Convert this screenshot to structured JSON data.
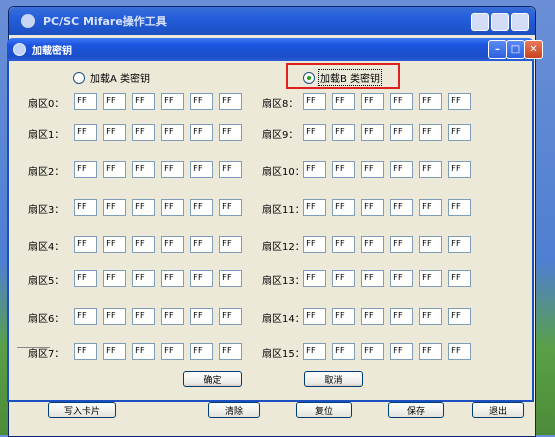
{
  "app_window": {
    "title": "PC/SC Mifare操作工具"
  },
  "bottom_buttons": {
    "write_card": "写入卡片",
    "clear": "清除",
    "reset": "复位",
    "save": "保存",
    "exit": "退出"
  },
  "dialog": {
    "title": "加载密钥",
    "radio_a_label": "加载A 类密钥",
    "radio_b_label": "加载B 类密钥",
    "selected_radio": "B",
    "ok_label": "确定",
    "cancel_label": "取消"
  },
  "sectors": [
    {
      "label": "扇区0：",
      "keys": [
        "FF",
        "FF",
        "FF",
        "FF",
        "FF",
        "FF"
      ]
    },
    {
      "label": "扇区1：",
      "keys": [
        "FF",
        "FF",
        "FF",
        "FF",
        "FF",
        "FF"
      ]
    },
    {
      "label": "扇区2：",
      "keys": [
        "FF",
        "FF",
        "FF",
        "FF",
        "FF",
        "FF"
      ]
    },
    {
      "label": "扇区3：",
      "keys": [
        "FF",
        "FF",
        "FF",
        "FF",
        "FF",
        "FF"
      ]
    },
    {
      "label": "扇区4：",
      "keys": [
        "FF",
        "FF",
        "FF",
        "FF",
        "FF",
        "FF"
      ]
    },
    {
      "label": "扇区5：",
      "keys": [
        "FF",
        "FF",
        "FF",
        "FF",
        "FF",
        "FF"
      ]
    },
    {
      "label": "扇区6：",
      "keys": [
        "FF",
        "FF",
        "FF",
        "FF",
        "FF",
        "FF"
      ]
    },
    {
      "label": "扇区7：",
      "keys": [
        "FF",
        "FF",
        "FF",
        "FF",
        "FF",
        "FF"
      ]
    },
    {
      "label": "扇区8：",
      "keys": [
        "FF",
        "FF",
        "FF",
        "FF",
        "FF",
        "FF"
      ]
    },
    {
      "label": "扇区9：",
      "keys": [
        "FF",
        "FF",
        "FF",
        "FF",
        "FF",
        "FF"
      ]
    },
    {
      "label": "扇区10：",
      "keys": [
        "FF",
        "FF",
        "FF",
        "FF",
        "FF",
        "FF"
      ]
    },
    {
      "label": "扇区11：",
      "keys": [
        "FF",
        "FF",
        "FF",
        "FF",
        "FF",
        "FF"
      ]
    },
    {
      "label": "扇区12：",
      "keys": [
        "FF",
        "FF",
        "FF",
        "FF",
        "FF",
        "FF"
      ]
    },
    {
      "label": "扇区13：",
      "keys": [
        "FF",
        "FF",
        "FF",
        "FF",
        "FF",
        "FF"
      ]
    },
    {
      "label": "扇区14：",
      "keys": [
        "FF",
        "FF",
        "FF",
        "FF",
        "FF",
        "FF"
      ]
    },
    {
      "label": "扇区15：",
      "keys": [
        "FF",
        "FF",
        "FF",
        "FF",
        "FF",
        "FF"
      ]
    }
  ]
}
